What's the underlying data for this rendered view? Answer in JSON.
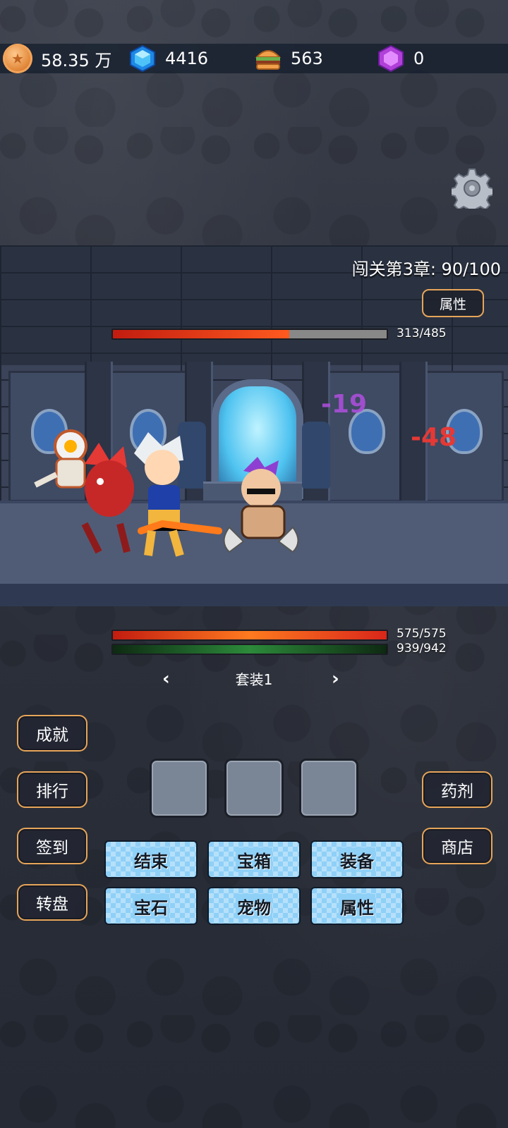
{
  "currencies": {
    "gold": {
      "value": "58.35 万",
      "icon": "gold-coin-icon"
    },
    "diamond": {
      "value": "4416",
      "icon": "blue-diamond-icon"
    },
    "food": {
      "value": "563",
      "icon": "burger-icon"
    },
    "purple_gem": {
      "value": "0",
      "icon": "purple-gem-icon"
    }
  },
  "settings_icon": "gear-icon",
  "battle": {
    "chapter_label": "闯关第3章: 90/100",
    "attr_button": "属性",
    "enemy_hp": {
      "current": 313,
      "max": 485,
      "text": "313/485"
    },
    "damage_numbers": [
      "-19",
      "-48"
    ],
    "player_hp": {
      "current": 575,
      "max": 575,
      "text": "575/575"
    },
    "player_mp": {
      "current": 939,
      "max": 942,
      "text": "939/942"
    }
  },
  "set_selector": {
    "label": "套装1",
    "prev_icon": "chevron-left-icon",
    "next_icon": "chevron-right-icon"
  },
  "left_buttons": [
    "成就",
    "排行",
    "签到",
    "转盘"
  ],
  "right_buttons": [
    "药剂",
    "商店"
  ],
  "menu_buttons": [
    "结束",
    "宝箱",
    "装备",
    "宝石",
    "宠物",
    "属性"
  ],
  "colors": {
    "hp_fill": "#e8401c",
    "mp_fill": "#1f6e2a",
    "button_border": "#e6a55a",
    "menu_bg": "#8fd0f7"
  }
}
